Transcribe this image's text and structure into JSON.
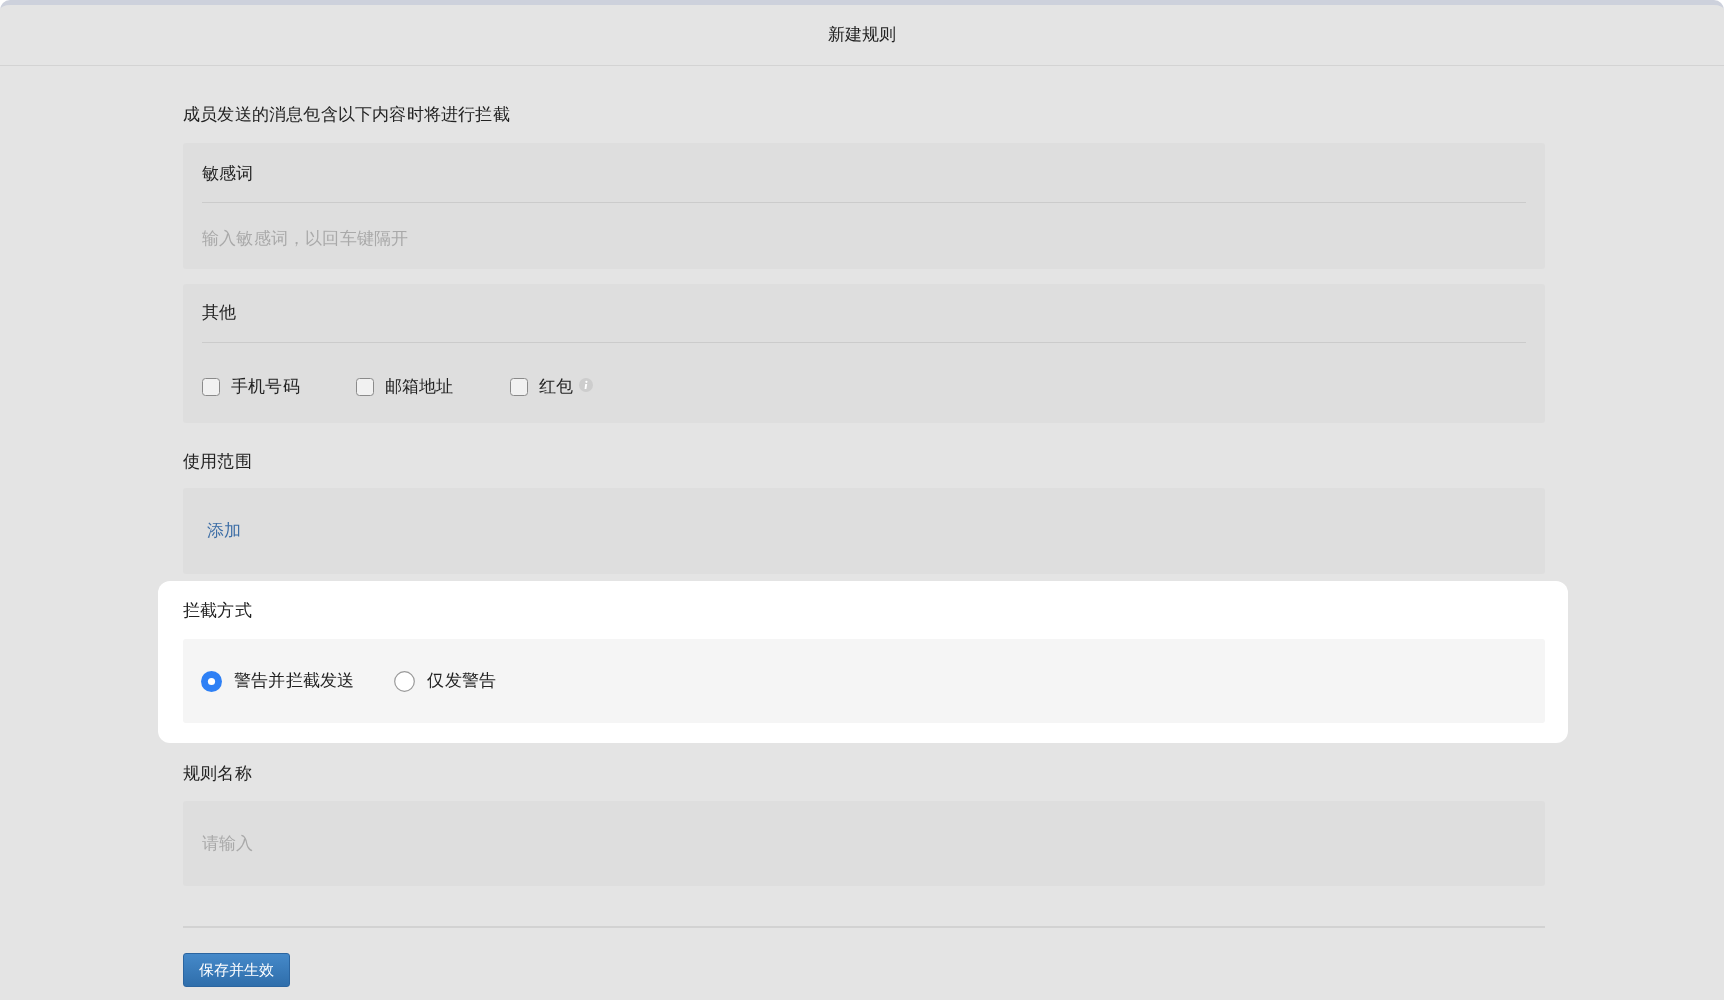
{
  "window": {
    "title": "新建规则"
  },
  "description": "成员发送的消息包含以下内容时将进行拦截",
  "sensitive_words": {
    "title": "敏感词",
    "placeholder": "输入敏感词，以回车键隔开"
  },
  "other": {
    "title": "其他",
    "options": [
      {
        "label": "手机号码",
        "checked": false,
        "info": false
      },
      {
        "label": "邮箱地址",
        "checked": false,
        "info": false
      },
      {
        "label": "红包",
        "checked": false,
        "info": true
      }
    ]
  },
  "scope": {
    "label": "使用范围",
    "add_link": "添加"
  },
  "intercept_mode": {
    "label": "拦截方式",
    "highlighted": true,
    "options": [
      {
        "label": "警告并拦截发送",
        "selected": true
      },
      {
        "label": "仅发警告",
        "selected": false
      }
    ]
  },
  "rule_name": {
    "label": "规则名称",
    "placeholder": "请输入"
  },
  "save_button": "保存并生效"
}
